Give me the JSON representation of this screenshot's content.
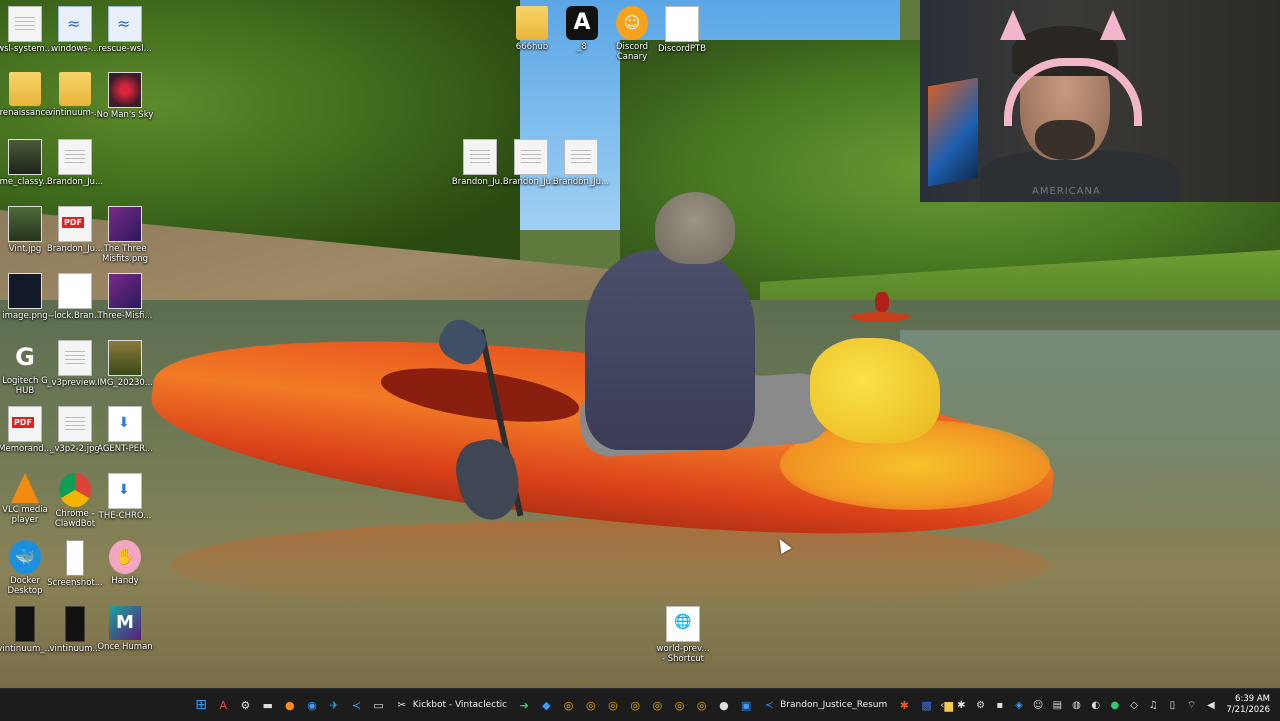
{
  "desktop": {
    "icons": [
      {
        "label": "wsl-system..."
      },
      {
        "label": "windows-..."
      },
      {
        "label": "rescue-wsl..."
      },
      {
        "label": "renaissance"
      },
      {
        "label": "vintinuum-..."
      },
      {
        "label": "No Man's Sky"
      },
      {
        "label": "me_classy..."
      },
      {
        "label": "Brandon_Ju..."
      },
      {
        "label": "Vint.jpg"
      },
      {
        "label": "Brandon_Ju..."
      },
      {
        "label": "The Three Misfits.png"
      },
      {
        "label": "image.png"
      },
      {
        "label": "--lock.Bran..."
      },
      {
        "label": "Three-Misfi..."
      },
      {
        "label": "Logitech G HUB"
      },
      {
        "label": "_v3preview..."
      },
      {
        "label": "IMG_20230..."
      },
      {
        "label": "Memorand..."
      },
      {
        "label": "_v3p2-2.jpg"
      },
      {
        "label": "AGENT-PER..."
      },
      {
        "label": "VLC media player"
      },
      {
        "label": "Chrome - ClawdBot"
      },
      {
        "label": "THE-CHRO..."
      },
      {
        "label": "Docker Desktop"
      },
      {
        "label": "Screenshot..."
      },
      {
        "label": "Handy"
      },
      {
        "label": "vintinuum_..."
      },
      {
        "label": "vintinuum..."
      },
      {
        "label": "Once Human"
      },
      {
        "label": "666hub"
      },
      {
        "label": "_8"
      },
      {
        "label": "Discord Canary"
      },
      {
        "label": "DiscordPTB"
      },
      {
        "label": "Brandon_Ju..."
      },
      {
        "label": "Brandon_Ju..."
      },
      {
        "label": "Brandon_Ju..."
      },
      {
        "label": "world-prev... - Shortcut"
      }
    ]
  },
  "webcam": {
    "shirt_text": "AMERICANA"
  },
  "taskbar": {
    "apps": [
      {
        "label": "Kickbot - Vintaclectic"
      },
      {
        "label": "Brandon_Justice_Resum"
      }
    ],
    "clock": {
      "time": "6:39 AM",
      "date": "7/21/2026"
    }
  },
  "colors": {
    "taskbar_bg": "#1c1c1c",
    "icon_label": "#ffffff",
    "accent": "#2a7dd8"
  }
}
